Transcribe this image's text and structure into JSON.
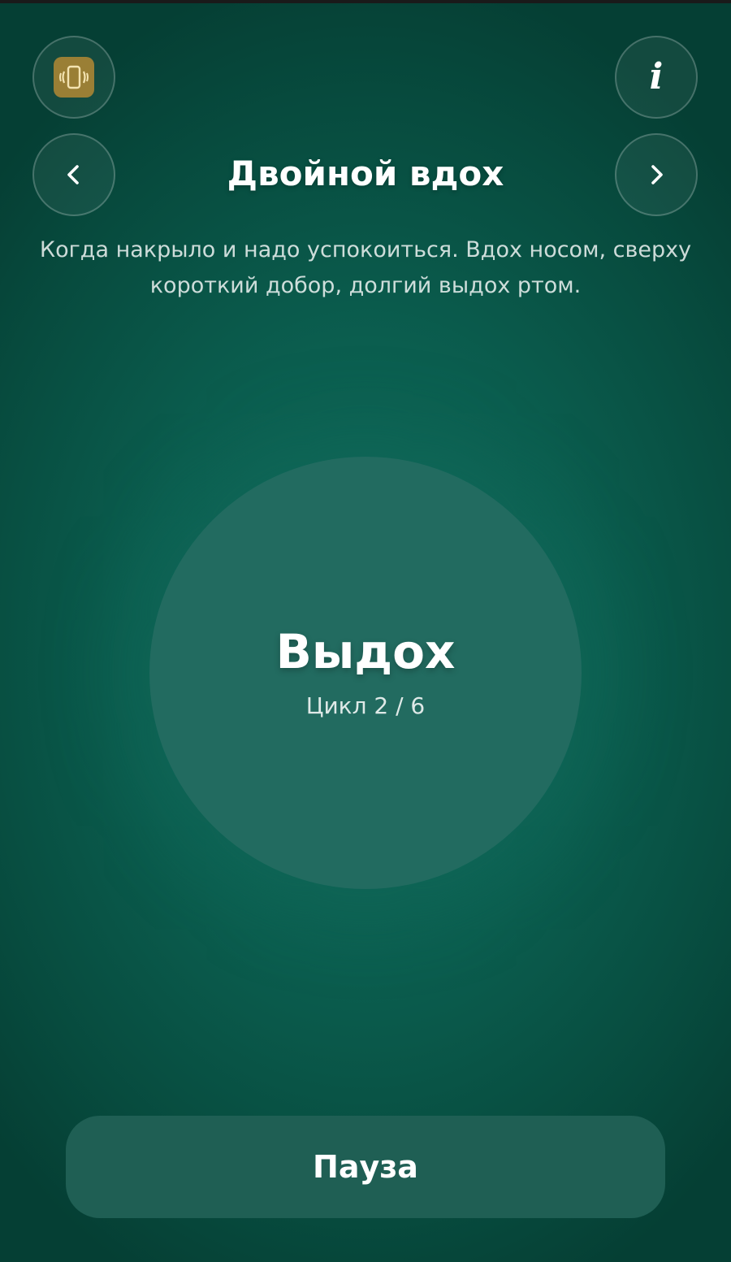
{
  "header": {
    "title": "Двойной вдох",
    "description": "Когда накрыло и надо успокоиться. Вдох носом, сверху короткий добор, долгий выдох ртом.",
    "vibrate_icon": "vibrate-icon",
    "info_icon": "info-icon",
    "info_glyph": "i",
    "prev_icon": "chevron-left-icon",
    "next_icon": "chevron-right-icon"
  },
  "breathing": {
    "phase": "Выдох",
    "cycle": "Цикл 2 / 6"
  },
  "controls": {
    "pause_label": "Пауза"
  },
  "colors": {
    "background": "#0b5e4f",
    "circle": "#226b60",
    "vibrate_badge": "#9a7f35",
    "pause_button": "#1f5f54"
  }
}
